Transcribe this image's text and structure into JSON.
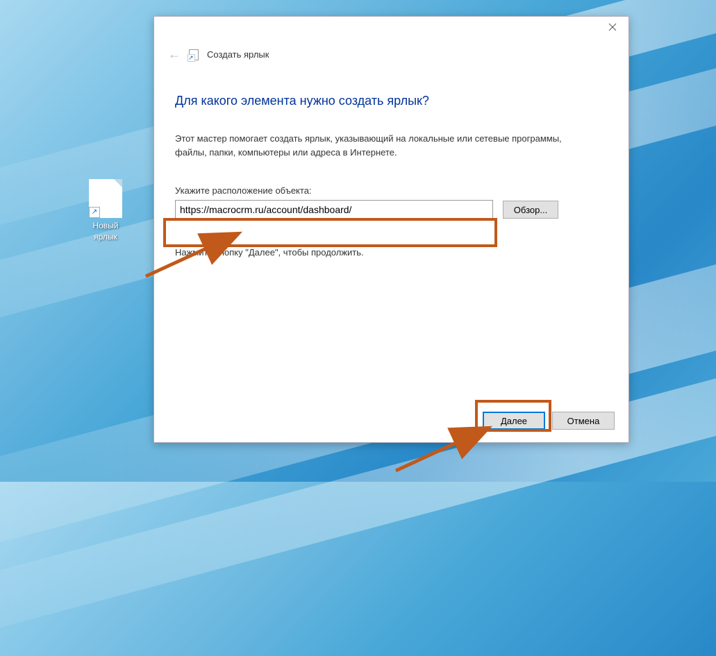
{
  "desktop": {
    "icon_label": "Новый ярлык"
  },
  "dialog": {
    "wizard_name": "Создать ярлык",
    "heading": "Для какого элемента нужно создать ярлык?",
    "description": "Этот мастер помогает создать ярлык, указывающий на локальные или сетевые программы, файлы, папки, компьютеры или адреса в Интернете.",
    "field_label": "Укажите расположение объекта:",
    "location_value": "https://macrocrm.ru/account/dashboard/",
    "browse_label": "Обзор...",
    "continue_text": "Нажмите кнопку \"Далее\", чтобы продолжить.",
    "next_label": "Далее",
    "cancel_label": "Отмена"
  },
  "colors": {
    "highlight": "#c1591a",
    "heading": "#003399",
    "accent": "#0078d7"
  }
}
